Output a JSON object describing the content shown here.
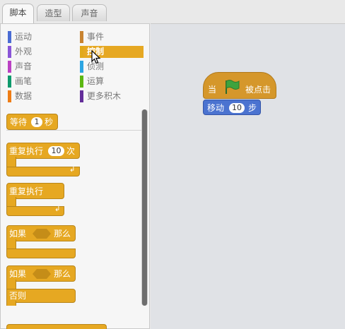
{
  "tabs": [
    {
      "label": "脚本",
      "active": true
    },
    {
      "label": "造型",
      "active": false
    },
    {
      "label": "声音",
      "active": false
    }
  ],
  "categories": [
    {
      "label": "运动",
      "color": "#4a6cd4"
    },
    {
      "label": "外观",
      "color": "#8a55d7"
    },
    {
      "label": "声音",
      "color": "#bb42c3"
    },
    {
      "label": "画笔",
      "color": "#0e9a6c"
    },
    {
      "label": "数据",
      "color": "#ee7d16"
    },
    {
      "label": "事件",
      "color": "#c88330"
    },
    {
      "label": "控制",
      "color": "#e1a91a",
      "selected": true
    },
    {
      "label": "侦测",
      "color": "#2ca5e2"
    },
    {
      "label": "运算",
      "color": "#5cb712"
    },
    {
      "label": "更多积木",
      "color": "#632d99"
    }
  ],
  "palette_blocks": {
    "wait": {
      "text": "等待",
      "value": "1",
      "unit": "秒"
    },
    "repeat": {
      "text": "重复执行",
      "value": "10",
      "unit": "次"
    },
    "forever": {
      "text": "重复执行"
    },
    "if_then": {
      "if": "如果",
      "then": "那么"
    },
    "if_else": {
      "if": "如果",
      "then": "那么",
      "else": "否则"
    }
  },
  "script": {
    "hat": {
      "when": "当",
      "clicked": "被点击",
      "flag_icon": "green-flag-icon"
    },
    "move": {
      "text": "移动",
      "value": "10",
      "unit": "步"
    }
  },
  "colors": {
    "control": "#e6a822",
    "events": "#d5972b",
    "motion": "#4b73d0",
    "flag": "#3ea33e"
  }
}
